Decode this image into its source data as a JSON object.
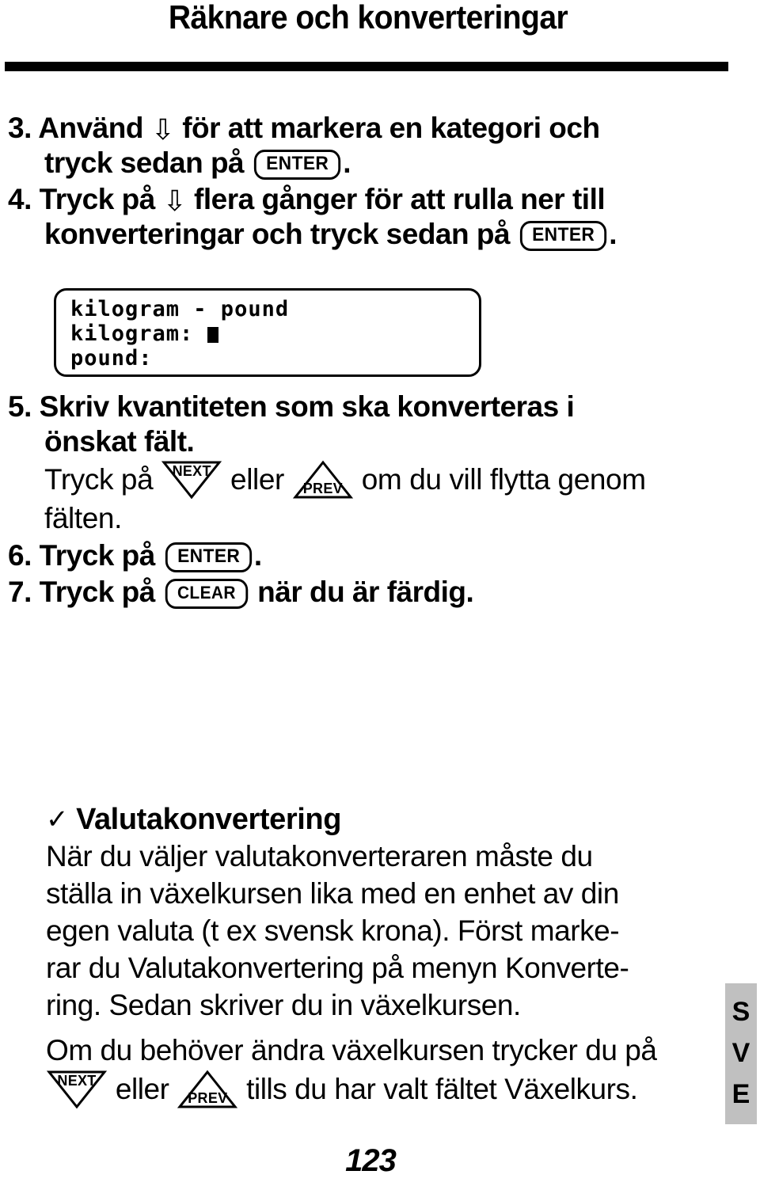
{
  "document": {
    "title": "Räknare och konverteringar",
    "page_number": "123",
    "side_tab_language": "SVE",
    "side_tab_letters": [
      "S",
      "V",
      "E"
    ]
  },
  "icons": {
    "down_arrow": "⇩",
    "checkmark": "✓",
    "next_key_label": "NEXT",
    "prev_key_label": "PREV",
    "enter_key_label": "ENTER",
    "clear_key_label": "CLEAR",
    "cursor_block": "block-cursor"
  },
  "steps": [
    {
      "number": "3.",
      "line1_before_arrow": "Använd ",
      "line1_after_arrow": " för att markera en kategori och",
      "line2_before_key": "tryck sedan på ",
      "key": "ENTER",
      "line2_after_key": "."
    },
    {
      "number": "4.",
      "line1_before_arrow": "Tryck på ",
      "line1_after_arrow": " flera gånger för att rulla ner till",
      "line2_before_key": "konverteringar och tryck sedan på ",
      "key": "ENTER",
      "line2_after_key": "."
    },
    {
      "number": "5.",
      "line1": "Skriv kvantiteten som ska konverteras i",
      "line2": "önskat fält.",
      "sub_before_next": "Tryck på ",
      "sub_between": " eller ",
      "sub_after_prev": " om du vill flytta genom",
      "sub_line2": "fälten."
    },
    {
      "number": "6.",
      "before_key": "Tryck på ",
      "key": "ENTER",
      "after_key": "."
    },
    {
      "number": "7.",
      "before_key": "Tryck på ",
      "key": "CLEAR",
      "after_key": " när du är färdig."
    }
  ],
  "lcd_display": {
    "line1": "kilogram - pound",
    "line2_label": "kilogram:",
    "line2_value": "",
    "line3_label": "pound:",
    "line3_value": ""
  },
  "section": {
    "heading": "Valutakonvertering",
    "paragraph1_lines": [
      "När du väljer valutakonverteraren måste du",
      "ställa in växelkursen lika med en enhet av din",
      "egen valuta (t ex svensk krona). Först marke-",
      "rar du Valutakonvertering på menyn Konverte-",
      "ring. Sedan skriver du in växelkursen."
    ],
    "paragraph2_line1": "Om du behöver ändra växelkursen trycker du på",
    "paragraph2_before_next": "",
    "paragraph2_between": " eller ",
    "paragraph2_after_prev": " tills du har valt fältet Växelkurs."
  },
  "colors": {
    "text": "#000000",
    "background": "#ffffff",
    "side_tab": "#c0c0c0",
    "rule": "#000000"
  }
}
